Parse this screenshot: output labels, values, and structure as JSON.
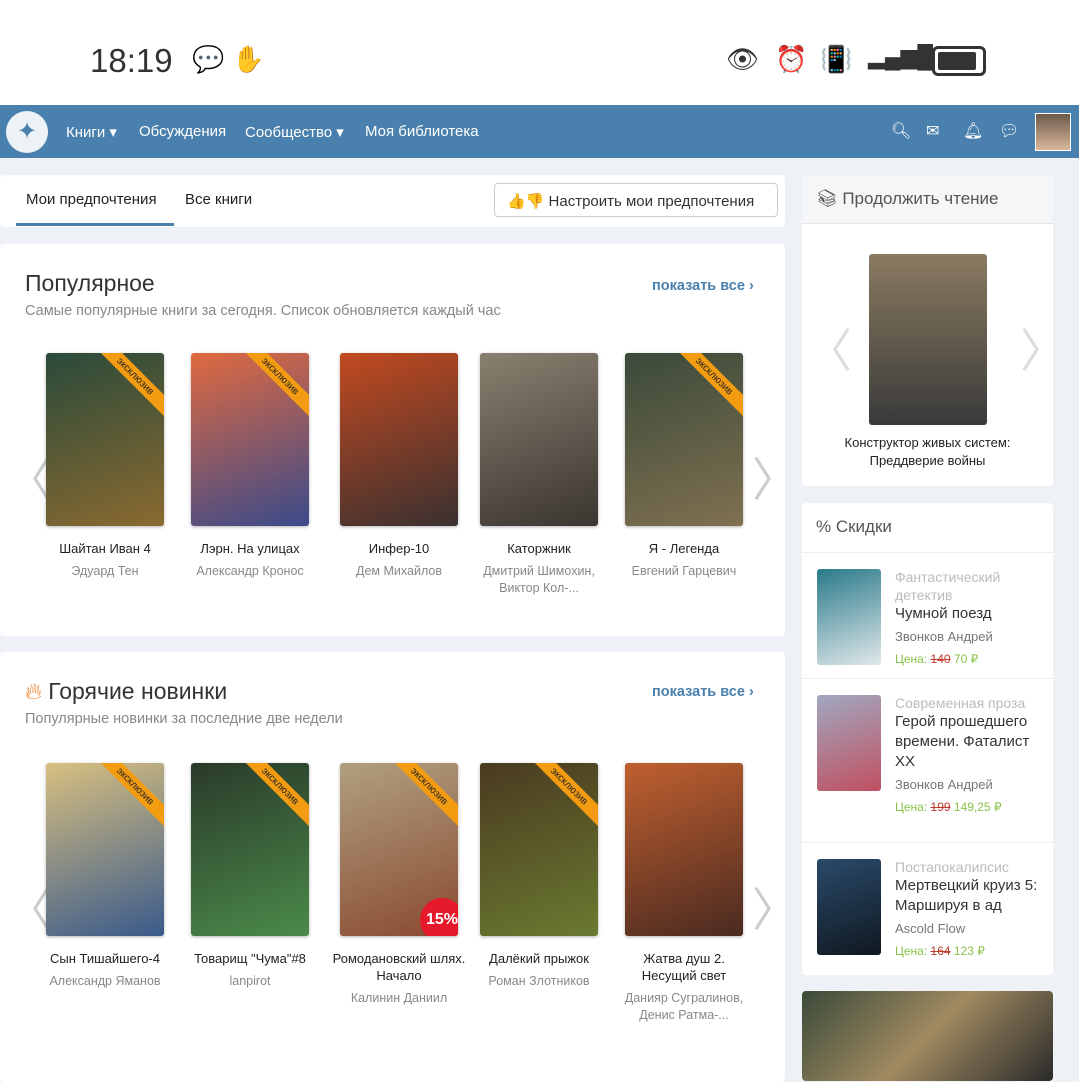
{
  "status_bar": {
    "time": "18:19"
  },
  "nav": {
    "items": [
      "Книги ▾",
      "Обсуждения",
      "Сообщество ▾",
      "Моя библиотека"
    ]
  },
  "tabs": {
    "items": [
      "Мои предпочтения",
      "Все книги"
    ],
    "pref_button": "Настроить мои предпочтения"
  },
  "popular": {
    "title": "Популярное",
    "subtitle": "Самые популярные книги за сегодня. Список обновляется каждый час",
    "show_all": "показать все ›",
    "books": [
      {
        "title": "Шайтан Иван 4",
        "author": "Эдуард Тен",
        "exclusive": "эксклюзив",
        "c1": "#2a4a3a",
        "c2": "#8a6a30"
      },
      {
        "title": "Лэрн. На улицах",
        "author": "Александр Кронос",
        "exclusive": "эксклюзив",
        "c1": "#e06a40",
        "c2": "#3a4a8a"
      },
      {
        "title": "Инфер-10",
        "author": "Дем Михайлов",
        "c1": "#c24a20",
        "c2": "#3a3030"
      },
      {
        "title": "Каторжник",
        "author": "Дмитрий Шимохин, Виктор Кол-...",
        "c1": "#8a8070",
        "c2": "#3a3530"
      },
      {
        "title": "Я - Легенда",
        "author": "Евгений Гарцевич",
        "exclusive": "эксклюзив",
        "c1": "#3a4a3a",
        "c2": "#807050"
      }
    ]
  },
  "hot": {
    "title": "Горячие новинки",
    "subtitle": "Популярные новинки за последние две недели",
    "show_all": "показать все ›",
    "books": [
      {
        "title": "Сын Тишайшего-4",
        "author": "Александр Яманов",
        "exclusive": "эксклюзив",
        "c1": "#d8c080",
        "c2": "#3a5a8a"
      },
      {
        "title": "Товарищ \"Чума\"#8",
        "author": "lanpirot",
        "exclusive": "эксклюзив",
        "c1": "#2a3a2a",
        "c2": "#4a8a4a"
      },
      {
        "title": "Ромодановский шлях. Начало",
        "author": "Калинин Даниил",
        "exclusive": "эксклюзив",
        "discount": "15%",
        "c1": "#b0a080",
        "c2": "#8a4a30"
      },
      {
        "title": "Далёкий прыжок",
        "author": "Роман Злотников",
        "exclusive": "эксклюзив",
        "c1": "#4a3a20",
        "c2": "#6a7a30"
      },
      {
        "title": "Жатва душ 2. Несущий свет",
        "author": "Данияр Сугралинов, Денис Ратма-...",
        "c1": "#c06030",
        "c2": "#4a2a20"
      }
    ]
  },
  "continue": {
    "title": "Продолжить чтение",
    "book": "Конструктор живых систем: Преддверие войны"
  },
  "sales": {
    "title": "% Скидки",
    "price_label": "Цена:",
    "items": [
      {
        "genre": "Фантастический детектив",
        "title": "Чумной поезд",
        "author": "Звонков Андрей",
        "old": "140",
        "new": "70 ₽",
        "c1": "#2a7a8a",
        "c2": "#e0e8ea"
      },
      {
        "genre": "Современная проза",
        "title": "Герой прошедшего времени. Фаталист XX",
        "author": "Звонков Андрей",
        "old": "199",
        "new": "149,25 ₽",
        "c1": "#a0a8c0",
        "c2": "#c05060"
      },
      {
        "genre": "Постапокалипсис",
        "title": "Мертвецкий круиз 5: Маршируя в ад",
        "author": "Ascold Flow",
        "old": "164",
        "new": "123 ₽",
        "c1": "#2a4a6a",
        "c2": "#101820"
      }
    ]
  }
}
